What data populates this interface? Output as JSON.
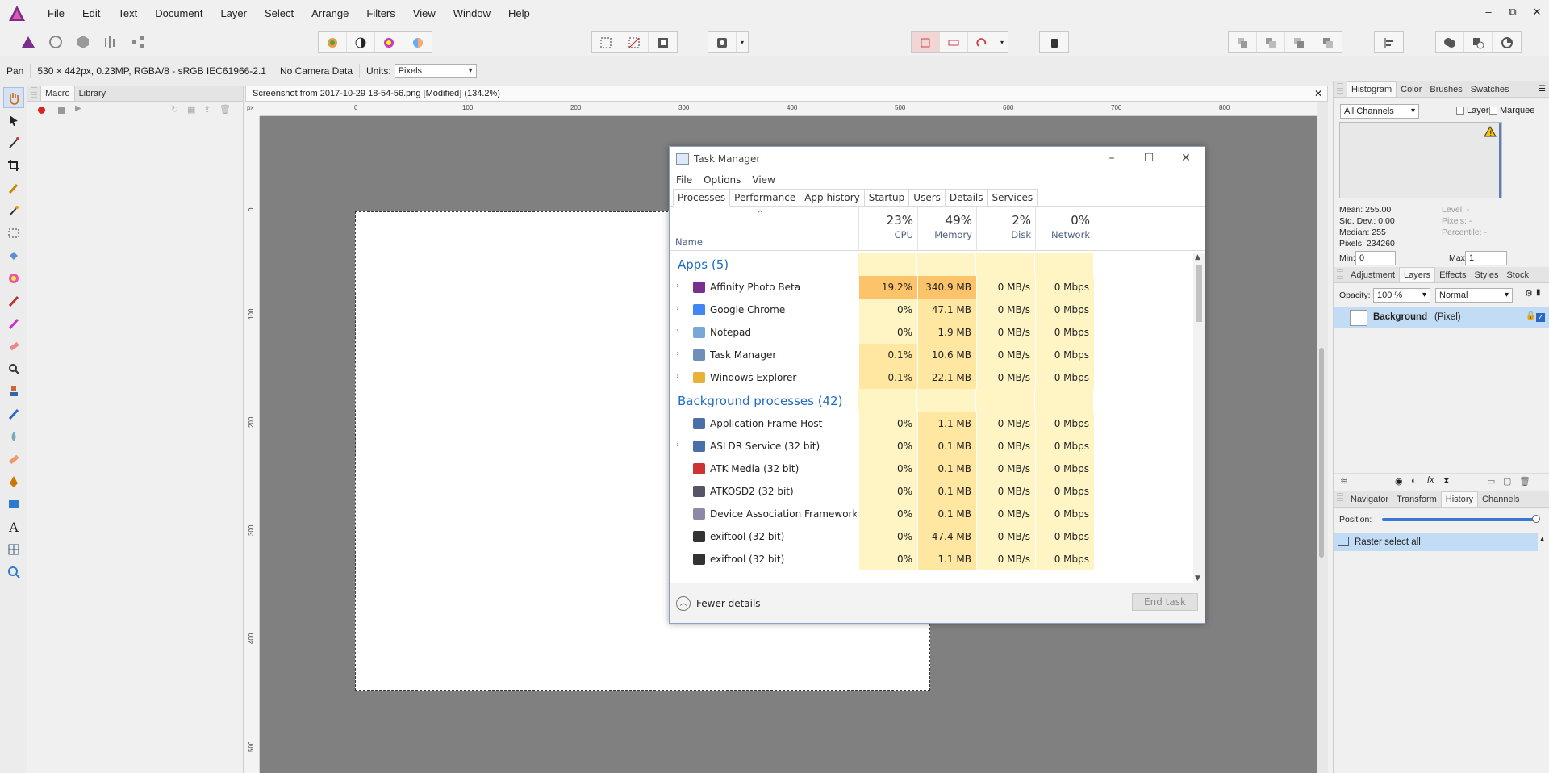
{
  "menu": [
    "File",
    "Edit",
    "Text",
    "Document",
    "Layer",
    "Select",
    "Arrange",
    "Filters",
    "View",
    "Window",
    "Help"
  ],
  "window_controls": [
    "–",
    "⧉",
    "✕"
  ],
  "context": {
    "tool": "Pan",
    "doc_info": "530 × 442px, 0.23MP, RGBA/8 - sRGB IEC61966-2.1",
    "camera": "No Camera Data",
    "units_label": "Units:",
    "units_value": "Pixels"
  },
  "left_panel": {
    "tabs": [
      "Macro",
      "Library"
    ]
  },
  "document": {
    "tab_title": "Screenshot from 2017-10-29 18-54-56.png [Modified] (134.2%)",
    "ruler_unit": "px",
    "ruler_h": [
      "0",
      "100",
      "200",
      "300",
      "400",
      "500",
      "600",
      "700",
      "800"
    ],
    "ruler_v": [
      "0",
      "100",
      "200",
      "300",
      "400",
      "500"
    ]
  },
  "task_manager": {
    "title": "Task Manager",
    "menu": [
      "File",
      "Options",
      "View"
    ],
    "tabs": [
      "Processes",
      "Performance",
      "App history",
      "Startup",
      "Users",
      "Details",
      "Services"
    ],
    "columns": {
      "name": "Name",
      "cpu": {
        "pct": "23%",
        "label": "CPU"
      },
      "memory": {
        "pct": "49%",
        "label": "Memory"
      },
      "disk": {
        "pct": "2%",
        "label": "Disk"
      },
      "network": {
        "pct": "0%",
        "label": "Network"
      }
    },
    "apps_header": "Apps (5)",
    "apps": [
      {
        "name": "Affinity Photo Beta",
        "cpu": "19.2%",
        "mem": "340.9 MB",
        "disk": "0 MB/s",
        "net": "0 Mbps",
        "expandable": true
      },
      {
        "name": "Google Chrome",
        "cpu": "0%",
        "mem": "47.1 MB",
        "disk": "0 MB/s",
        "net": "0 Mbps",
        "expandable": true
      },
      {
        "name": "Notepad",
        "cpu": "0%",
        "mem": "1.9 MB",
        "disk": "0 MB/s",
        "net": "0 Mbps",
        "expandable": true
      },
      {
        "name": "Task Manager",
        "cpu": "0.1%",
        "mem": "10.6 MB",
        "disk": "0 MB/s",
        "net": "0 Mbps",
        "expandable": true
      },
      {
        "name": "Windows Explorer",
        "cpu": "0.1%",
        "mem": "22.1 MB",
        "disk": "0 MB/s",
        "net": "0 Mbps",
        "expandable": true
      }
    ],
    "bg_header": "Background processes (42)",
    "background": [
      {
        "name": "Application Frame Host",
        "cpu": "0%",
        "mem": "1.1 MB",
        "disk": "0 MB/s",
        "net": "0 Mbps",
        "expandable": false
      },
      {
        "name": "ASLDR Service (32 bit)",
        "cpu": "0%",
        "mem": "0.1 MB",
        "disk": "0 MB/s",
        "net": "0 Mbps",
        "expandable": true
      },
      {
        "name": "ATK Media (32 bit)",
        "cpu": "0%",
        "mem": "0.1 MB",
        "disk": "0 MB/s",
        "net": "0 Mbps",
        "expandable": false
      },
      {
        "name": "ATKOSD2 (32 bit)",
        "cpu": "0%",
        "mem": "0.1 MB",
        "disk": "0 MB/s",
        "net": "0 Mbps",
        "expandable": false
      },
      {
        "name": "Device Association Framework ...",
        "cpu": "0%",
        "mem": "0.1 MB",
        "disk": "0 MB/s",
        "net": "0 Mbps",
        "expandable": false
      },
      {
        "name": "exiftool (32 bit)",
        "cpu": "0%",
        "mem": "47.4 MB",
        "disk": "0 MB/s",
        "net": "0 Mbps",
        "expandable": false
      },
      {
        "name": "exiftool (32 bit)",
        "cpu": "0%",
        "mem": "1.1 MB",
        "disk": "0 MB/s",
        "net": "0 Mbps",
        "expandable": false
      }
    ],
    "fewer_details": "Fewer details",
    "end_task": "End task"
  },
  "histogram": {
    "tabs": [
      "Histogram",
      "Color",
      "Brushes",
      "Swatches"
    ],
    "channel": "All Channels",
    "layer_label": "Layer",
    "marquee_label": "Marquee",
    "stats_left": [
      "Mean: 255.00",
      "Std. Dev.: 0.00",
      "Median: 255",
      "Pixels: 234260"
    ],
    "stats_right": [
      "Level: -",
      "Pixels: -",
      "Percentile: -"
    ],
    "min_label": "Min:",
    "min_value": "0",
    "max_label": "Max:",
    "max_value": "1"
  },
  "layers": {
    "tabs": [
      "Adjustment",
      "Layers",
      "Effects",
      "Styles",
      "Stock"
    ],
    "opacity_label": "Opacity:",
    "opacity_value": "100 %",
    "blend_mode": "Normal",
    "layer_name": "Background",
    "layer_type": "(Pixel)"
  },
  "history": {
    "tabs": [
      "Navigator",
      "Transform",
      "History",
      "Channels"
    ],
    "position_label": "Position:",
    "position": 1.0,
    "entry": "Raster select all"
  },
  "colors": {
    "accent": "#1e6cc4",
    "selection": "#c3dcf5",
    "canvas_bg": "#808080"
  }
}
